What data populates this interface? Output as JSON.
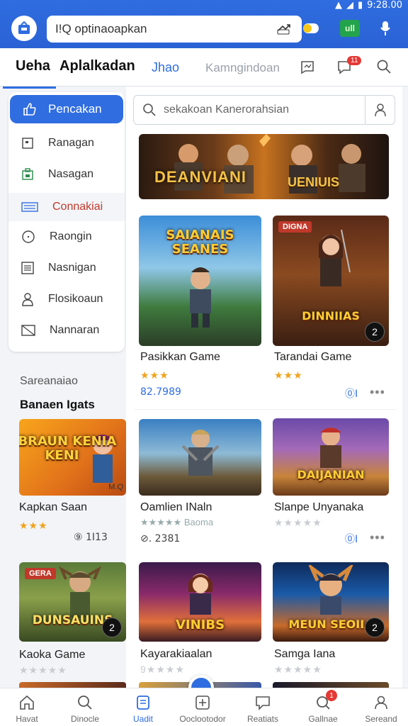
{
  "status": {
    "time": "9:28.00"
  },
  "browser": {
    "url": "I!Q optinaoapkan"
  },
  "tabs": [
    {
      "label": "Ueha"
    },
    {
      "label": "Aplalkadan"
    },
    {
      "label": "Jhao"
    },
    {
      "label": "Kamngindoan"
    }
  ],
  "tab_badge": "11",
  "sidebar": {
    "primary": "Pencakan",
    "items": [
      {
        "label": "Ranagan"
      },
      {
        "label": "Nasagan"
      },
      {
        "label": "Connakiai"
      },
      {
        "label": "Raongin"
      },
      {
        "label": "Nasnigan"
      },
      {
        "label": "Flosikoaun"
      },
      {
        "label": "Nannaran"
      }
    ]
  },
  "section": {
    "title": "Sareanaiao",
    "subtitle": "Banaen Igats"
  },
  "search": {
    "placeholder": "sekakoan Kanerorahsian"
  },
  "banner": {
    "title_left": "DEANVIANI",
    "title_right": "UENIUIS"
  },
  "cards": [
    {
      "logo": "SAIANAIS SEANES",
      "title": "Pasikkan Game",
      "stars": "★★★",
      "meta": "82.7989"
    },
    {
      "logo": "DINNIIAS",
      "tag": "DIGNA",
      "badge": "2",
      "title": "Tarandai Game",
      "stars": "★★★",
      "meta": "⓪I"
    },
    {
      "logo": "GBRAUN KENIA KENI",
      "corner": "M.Q",
      "title": "Kapkan Saan",
      "stars": "★★★",
      "meta": "⑨ 1I13"
    },
    {
      "logo": "",
      "title": "Oamlien INaln",
      "sub": "★★★★★ Baoma",
      "meta": "⊘. 2381"
    },
    {
      "logo": "DAIJANIAN",
      "title": "Slanpe Unyanaka",
      "stars": "★★★★★",
      "meta": "⓪I"
    },
    {
      "logo": "DUNSAUINS",
      "tag": "GERA",
      "badge": "2",
      "title": "Kaoka Game",
      "stars": "★★★★★"
    },
    {
      "logo": "VINIBS",
      "title": "Kayarakiaalan",
      "stars": "9★★★★"
    },
    {
      "logo": "MEUN SEOIIA",
      "badge": "2",
      "title": "Samga Iana",
      "stars": "★★★★★"
    }
  ],
  "more_label": "•••",
  "bottom_nav": [
    {
      "label": "Havat"
    },
    {
      "label": "Dinocle"
    },
    {
      "label": "Uadit"
    },
    {
      "label": "Ooclootodor"
    },
    {
      "label": "Reatiats"
    },
    {
      "label": "Gallnae",
      "badge": "1"
    },
    {
      "label": "Sereand"
    }
  ],
  "colors": {
    "accent": "#2f6de0",
    "star": "#f1a21b",
    "badge": "#e53935"
  }
}
